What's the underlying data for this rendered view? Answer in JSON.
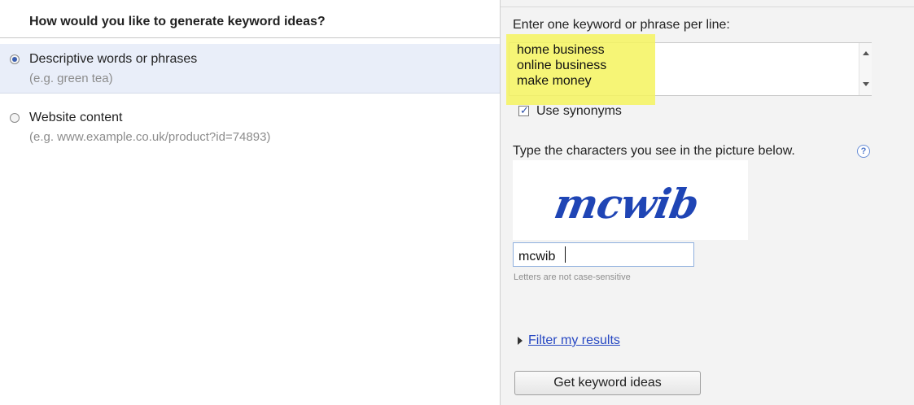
{
  "left_panel": {
    "title": "How would you like to generate keyword ideas?",
    "options": [
      {
        "label": "Descriptive words or phrases",
        "hint": "(e.g. green tea)",
        "selected": true
      },
      {
        "label": "Website content",
        "hint": "(e.g. www.example.co.uk/product?id=74893)",
        "selected": false
      }
    ]
  },
  "right_panel": {
    "prompt": "Enter one keyword or phrase per line:",
    "keywords": [
      "home business",
      "online business",
      "make money"
    ],
    "synonyms_label": "Use synonyms",
    "synonyms_checked": true,
    "captcha_prompt": "Type the characters you see in the picture below.",
    "captcha_image_text": "mcwib",
    "captcha_input_value": "mcwib",
    "case_note": "Letters are not case-sensitive",
    "filter_link": "Filter my results",
    "submit_button": "Get keyword ideas"
  },
  "icons": {
    "radio": "radio-icon",
    "checkbox": "checkbox-icon",
    "help": "question-mark-icon",
    "expand": "triangle-right-icon"
  },
  "colors": {
    "link": "#2647c2",
    "highlight": "#f4f35e",
    "selected_row": "#e9eef9",
    "captcha_ink": "#1f45b5"
  }
}
